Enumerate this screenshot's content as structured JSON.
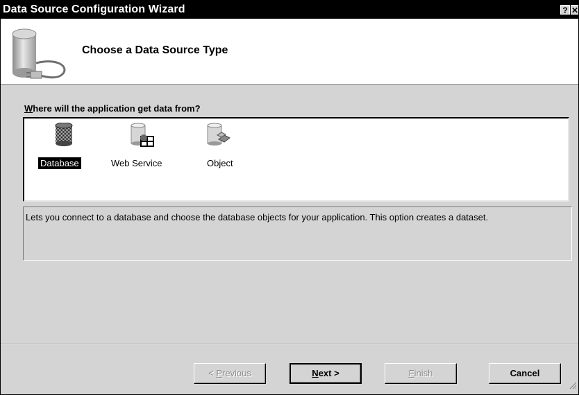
{
  "window": {
    "title": "Data Source Configuration Wizard",
    "help_label": "?",
    "close_label": "✕"
  },
  "header": {
    "title": "Choose a Data Source Type",
    "icon": "database-plug-icon"
  },
  "prompt": {
    "accel": "W",
    "rest": "here will the application get data from?"
  },
  "source_types": [
    {
      "label": "Database",
      "icon": "database-icon",
      "selected": true
    },
    {
      "label": "Web Service",
      "icon": "web-service-icon",
      "selected": false
    },
    {
      "label": "Object",
      "icon": "object-icon",
      "selected": false
    }
  ],
  "description": "Lets you connect to a database and choose the database objects for your application. This option creates a dataset.",
  "buttons": {
    "previous": {
      "prefix": "< ",
      "accel": "P",
      "rest": "revious",
      "enabled": false
    },
    "next": {
      "accel": "N",
      "rest": "ext >",
      "enabled": true
    },
    "finish": {
      "accel": "F",
      "rest": "inish",
      "enabled": false
    },
    "cancel": {
      "label": "Cancel",
      "enabled": true
    }
  }
}
